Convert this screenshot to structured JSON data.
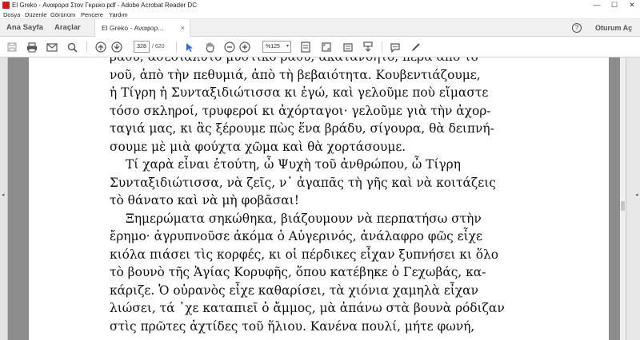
{
  "window": {
    "title": "El Greko - Αναφορα Στον Γκρεκο.pdf - Adobe Acrobat Reader DC",
    "minimize": "—",
    "maximize": "☐",
    "close": "✕"
  },
  "menu": [
    "Dosya",
    "Düzenle",
    "Görünüm",
    "Pencere",
    "Yardım"
  ],
  "tabs": {
    "home": "Ana Sayfa",
    "tools": "Araçlar",
    "document": "El Greko - Αναφορ...",
    "document_close": "×",
    "help": "?",
    "sign_in": "Oturum Aç"
  },
  "toolbar": {
    "page_current": "328",
    "page_total": "/ 620",
    "zoom": "%125",
    "zoom_dropdown": "▾"
  },
  "panels": {
    "left_arrow": "◂",
    "right_arrow": "◂"
  },
  "document": {
    "lines": [
      "βάθυ, ἀσέσιαλυτο μυστικό ράθυ, ἀκατανόητο, πέρα ἀπὸ τὸ",
      "νοῦ, ἀπὸ τὴν πεθυμιά, ἀπὸ τὴ βεβαιότητα. Κουβεντιάζουμε,",
      "ἡ Τίγρη ἡ Συνταξιδιώτισσα κι ἐγώ, καὶ γελοῦμε ποὺ εἴμαστε",
      "τόσο σκληροί, τρυφεροί κι ἀχόρταγοι· γελοῦμε γιὰ τὴν ἀχορ-",
      "ταγιά μας, κι ἂς ξέρουμε πὼς ἕνα βράδυ, σίγουρα, θὰ δειπνή-",
      "σουμε μὲ μιὰ φούχτα χῶμα καὶ θὰ χορτάσουμε.",
      "Τί χαρὰ εἶναι ἐτούτη, ὦ Ψυχὴ τοῦ ἀνθρώπου, ὦ Τίγρη",
      "Συνταξιδιώτισσα, νὰ ζεῖς, ν᾿ ἀγαπᾶς τὴ γῆς καὶ νὰ κοιτάζεις",
      "τὸ θάνατο καὶ νὰ μὴ φοβᾶσαι!",
      "Ξημερώματα σηκώθηκα, βιάζουμουν νὰ περπατήσω στὴν",
      "ἔρημο· ἀγρυπνοῦσε ἀκόμα ὁ Αὐγερινός, ἀνάλαφρο φῶς εἶχε",
      "κιόλα πιάσει τὶς κορφές, κι οἱ πέρδικες εἶχαν ξυπνήσει κι ὅλο",
      "τὸ βουνὸ τῆς Ἁγίας Κορυφῆς, ὅπου κατέβηκε ὁ Γεχωβάς, κα-",
      "κάριζε. Ὁ οὐρανὸς εἶχε καθαρίσει, τὰ χιόνια χαμηλὰ εἶχαν",
      "λιώσει, τά ᾿χε καταπιεῖ ὁ ἄμμος, μὰ ἀπάνω στὰ βουνὰ ρόδιζαν",
      "στὶς πρῶτες ἀχτίδες τοῦ ἥλιου. Κανένα πουλί, μήτε φωνή,"
    ]
  }
}
